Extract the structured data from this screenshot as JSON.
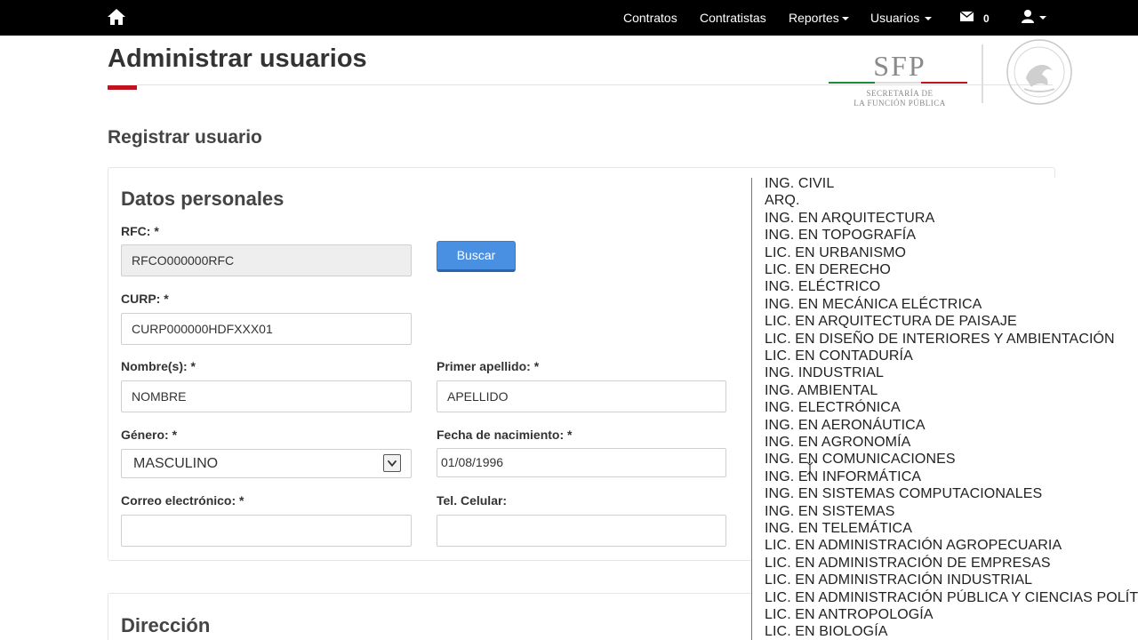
{
  "nav": {
    "items": [
      "Contratos",
      "Contratistas",
      "Reportes",
      "Usuarios"
    ],
    "mail_count": "0"
  },
  "header": {
    "title": "Administrar usuarios",
    "logo": {
      "acronym": "SFP",
      "line1": "SECRETARÍA DE",
      "line2": "LA FUNCIÓN PÚBLICA"
    }
  },
  "section_title": "Registrar usuario",
  "personal": {
    "heading": "Datos personales",
    "rfc_label": "RFC: *",
    "rfc_value": "RFCO000000RFC",
    "search_button": "Buscar",
    "curp_label": "CURP: *",
    "curp_value": "CURP000000HDFXXX01",
    "nombre_label": "Nombre(s): *",
    "nombre_value": "NOMBRE",
    "apellido_label": "Primer apellido: *",
    "apellido_value": "APELLIDO",
    "genero_label": "Género: *",
    "genero_value": "MASCULINO",
    "fecha_label": "Fecha de nacimiento: *",
    "fecha_value": "01/08/1996",
    "correo_label": "Correo electrónico: *",
    "correo_value": "",
    "tel_label": "Tel. Celular:",
    "tel_value": ""
  },
  "address": {
    "heading": "Dirección"
  },
  "dropdown_options": [
    "ING. CIVIL",
    "ARQ.",
    "ING. EN ARQUITECTURA",
    "ING. EN TOPOGRAFÍA",
    "LIC. EN URBANISMO",
    "LIC. EN DERECHO",
    "ING. ELÉCTRICO",
    "ING. EN MECÁNICA ELÉCTRICA",
    "LIC. EN ARQUITECTURA DE PAISAJE",
    "LIC. EN DISEÑO DE INTERIORES Y AMBIENTACIÓN",
    "LIC. EN CONTADURÍA",
    "ING. INDUSTRIAL",
    "ING. AMBIENTAL",
    "ING. ELECTRÓNICA",
    "ING. EN AERONÁUTICA",
    "ING. EN AGRONOMÍA",
    "ING. EN COMUNICACIONES",
    "ING. EN INFORMÁTICA",
    "ING. EN SISTEMAS COMPUTACIONALES",
    "ING. EN SISTEMAS",
    "ING. EN TELEMÁTICA",
    "LIC. EN ADMINISTRACIÓN AGROPECUARIA",
    "LIC. EN ADMINISTRACIÓN DE EMPRESAS",
    "LIC. EN ADMINISTRACIÓN INDUSTRIAL",
    "LIC. EN ADMINISTRACIÓN PÚBLICA Y CIENCIAS POLÍTICAS",
    "LIC. EN ANTROPOLOGÍA",
    "LIC. EN BIOLOGÍA"
  ],
  "colors": {
    "navbar": "#000000",
    "accent_red": "#c1121f",
    "button_blue": "#4a90e2"
  }
}
